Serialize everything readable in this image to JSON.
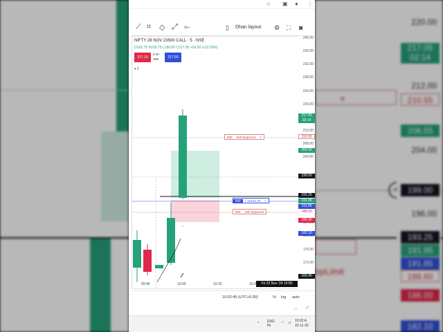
{
  "browser": {
    "star_icon": "star-icon",
    "ext_icon": "extension-icon",
    "profile_icon": "profile-icon",
    "menu_icon": "more-icon"
  },
  "toolbar": {
    "layout_label": "Dhan layout"
  },
  "symbol": {
    "title": "NIFTY 28 NOV 23500 CALL · 5 · NSE",
    "ohlc": "O192.75 H218.75 L186.00 C217.05 +24.20 (+12.55%)"
  },
  "quote": {
    "sell": "217.10",
    "spread_top": "0.40",
    "qty": "600",
    "buy": "217.50",
    "collapse": "2"
  },
  "price_scale": [
    "240.00",
    "236.00",
    "232.00",
    "228.00",
    "224.00",
    "220.00",
    "216.00",
    "212.00",
    "208.00",
    "204.00",
    "200.00",
    "196.00",
    "192.00",
    "188.00",
    "184.00",
    "180.00",
    "176.00",
    "172.00"
  ],
  "price_tags": {
    "last": "217.05",
    "countdown": "02:14",
    "sl_order": "210.55",
    "sl_order2": "206.55",
    "cursor": "199.00",
    "buy_line": "193.25",
    "ask": "191.95",
    "bid": "191.85",
    "sl2": "188.60",
    "low": "186.00",
    "avg": "182.10",
    "bottom": "169.40"
  },
  "orders": {
    "sl1_qty": "600",
    "sl1_label": "Sell StopLimit",
    "close": "×",
    "pos_qty": "600",
    "pos_pl": "+ 15123.75",
    "sl2_qty": "600",
    "sl2_label": "Sell StopLimit"
  },
  "x_axis": [
    "09:45",
    "10:00",
    "10:15",
    "10:30"
  ],
  "date_tag": "Fri 22 Nov '24   10:50",
  "bottom": {
    "time": "10:02:45 (UTC+5:30)",
    "pct": "%",
    "log": "log",
    "auto": "auto"
  },
  "tray": {
    "lang": "ENG",
    "region": "IN",
    "clock": "10:02 A",
    "date": "22-11-20"
  },
  "bg_scale": [
    "220.00",
    "212.00",
    "204.00",
    "196.00",
    "188.00"
  ],
  "bg_tags": {
    "t1": "217.05",
    "t1b": "02:14",
    "t2": "210.55",
    "t3": "206.55",
    "t4": "199.00",
    "t5": "193.25",
    "t6": "191.95",
    "t7": "191.85",
    "t8": "188.60",
    "t9": "186.00",
    "t10": "182.10"
  },
  "colors": {
    "bull": "#26a17b",
    "bear": "#e0294a",
    "blue": "#3250d8",
    "dark": "#131722"
  }
}
